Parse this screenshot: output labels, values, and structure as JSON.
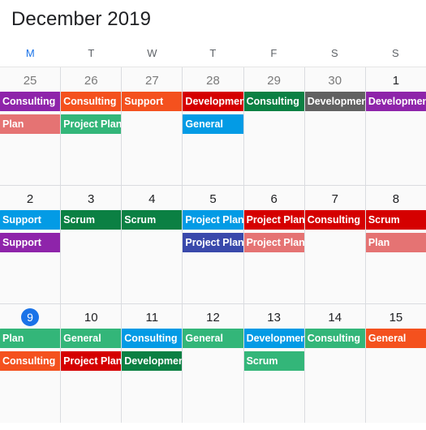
{
  "header": {
    "title": "December 2019"
  },
  "weekdays": [
    {
      "label": "M",
      "today_column": true
    },
    {
      "label": "T",
      "today_column": false
    },
    {
      "label": "W",
      "today_column": false
    },
    {
      "label": "T",
      "today_column": false
    },
    {
      "label": "F",
      "today_column": false
    },
    {
      "label": "S",
      "today_column": false
    },
    {
      "label": "S",
      "today_column": false
    }
  ],
  "colors": {
    "today_badge": "#1a73e8",
    "today_weekday": "#1a73e8",
    "grid_line": "#dadce0",
    "cell_background": "#fafafa",
    "current_month_date": "#202124",
    "other_month_date": "#7a7a7a",
    "purple": "#8e24aa",
    "salmon": "#e57373",
    "orange": "#f4511e",
    "green": "#33b679",
    "teal_green": "#0b8043",
    "red": "#d50000",
    "blue": "#039be5",
    "gray": "#616161",
    "indigo": "#3949ab"
  },
  "weeks": [
    {
      "days": [
        {
          "date": "25",
          "other_month": true,
          "today": false,
          "events": [
            {
              "label": "Consulting",
              "color": "#8e24aa"
            },
            {
              "label": "Plan",
              "color": "#e57373"
            }
          ]
        },
        {
          "date": "26",
          "other_month": true,
          "today": false,
          "events": [
            {
              "label": "Consulting",
              "color": "#f4511e"
            },
            {
              "label": "Project Plan",
              "color": "#33b679"
            }
          ]
        },
        {
          "date": "27",
          "other_month": true,
          "today": false,
          "events": [
            {
              "label": "Support",
              "color": "#f4511e"
            }
          ]
        },
        {
          "date": "28",
          "other_month": true,
          "today": false,
          "events": [
            {
              "label": "Development",
              "color": "#d50000"
            },
            {
              "label": "General",
              "color": "#039be5"
            }
          ]
        },
        {
          "date": "29",
          "other_month": true,
          "today": false,
          "events": [
            {
              "label": "Consulting",
              "color": "#0b8043"
            }
          ]
        },
        {
          "date": "30",
          "other_month": true,
          "today": false,
          "events": [
            {
              "label": "Development",
              "color": "#616161"
            }
          ]
        },
        {
          "date": "1",
          "other_month": false,
          "today": false,
          "events": [
            {
              "label": "Development",
              "color": "#8e24aa"
            }
          ]
        }
      ]
    },
    {
      "days": [
        {
          "date": "2",
          "other_month": false,
          "today": false,
          "events": [
            {
              "label": "Support",
              "color": "#039be5"
            },
            {
              "label": "Support",
              "color": "#8e24aa"
            }
          ]
        },
        {
          "date": "3",
          "other_month": false,
          "today": false,
          "events": [
            {
              "label": "Scrum",
              "color": "#0b8043"
            }
          ]
        },
        {
          "date": "4",
          "other_month": false,
          "today": false,
          "events": [
            {
              "label": "Scrum",
              "color": "#0b8043"
            }
          ]
        },
        {
          "date": "5",
          "other_month": false,
          "today": false,
          "events": [
            {
              "label": "Project Plan",
              "color": "#039be5"
            },
            {
              "label": "Project Plan",
              "color": "#3949ab"
            }
          ]
        },
        {
          "date": "6",
          "other_month": false,
          "today": false,
          "events": [
            {
              "label": "Project Plan",
              "color": "#d50000"
            },
            {
              "label": "Project Plan",
              "color": "#e57373"
            }
          ]
        },
        {
          "date": "7",
          "other_month": false,
          "today": false,
          "events": [
            {
              "label": "Consulting",
              "color": "#d50000"
            }
          ]
        },
        {
          "date": "8",
          "other_month": false,
          "today": false,
          "events": [
            {
              "label": "Scrum",
              "color": "#d50000"
            },
            {
              "label": "Plan",
              "color": "#e57373"
            }
          ]
        }
      ]
    },
    {
      "days": [
        {
          "date": "9",
          "other_month": false,
          "today": true,
          "events": [
            {
              "label": "Plan",
              "color": "#33b679"
            },
            {
              "label": "Consulting",
              "color": "#f4511e"
            }
          ]
        },
        {
          "date": "10",
          "other_month": false,
          "today": false,
          "events": [
            {
              "label": "General",
              "color": "#33b679"
            },
            {
              "label": "Project Plan",
              "color": "#d50000"
            }
          ]
        },
        {
          "date": "11",
          "other_month": false,
          "today": false,
          "events": [
            {
              "label": "Consulting",
              "color": "#039be5"
            },
            {
              "label": "Development",
              "color": "#0b8043"
            }
          ]
        },
        {
          "date": "12",
          "other_month": false,
          "today": false,
          "events": [
            {
              "label": "General",
              "color": "#33b679"
            }
          ]
        },
        {
          "date": "13",
          "other_month": false,
          "today": false,
          "events": [
            {
              "label": "Development",
              "color": "#039be5"
            },
            {
              "label": "Scrum",
              "color": "#33b679"
            }
          ]
        },
        {
          "date": "14",
          "other_month": false,
          "today": false,
          "events": [
            {
              "label": "Consulting",
              "color": "#33b679"
            }
          ]
        },
        {
          "date": "15",
          "other_month": false,
          "today": false,
          "events": [
            {
              "label": "General",
              "color": "#f4511e"
            }
          ]
        }
      ]
    }
  ]
}
